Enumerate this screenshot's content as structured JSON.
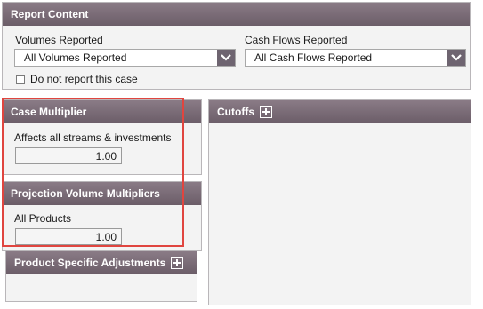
{
  "report_content": {
    "title": "Report Content",
    "volumes_label": "Volumes Reported",
    "volumes_value": "All Volumes Reported",
    "cashflows_label": "Cash Flows Reported",
    "cashflows_value": "All Cash Flows Reported",
    "do_not_report_label": "Do not report this case",
    "do_not_report_checked": false
  },
  "case_multiplier": {
    "title": "Case Multiplier",
    "description": "Affects all streams & investments",
    "value": "1.00"
  },
  "projection_volume_multipliers": {
    "title": "Projection Volume Multipliers",
    "label": "All Products",
    "value": "1.00"
  },
  "product_specific_adjustments": {
    "title": "Product Specific Adjustments"
  },
  "cutoffs": {
    "title": "Cutoffs"
  },
  "colors": {
    "header_bg": "#7a6c77",
    "dropdown_caret_bg": "#6e6470",
    "highlight_border": "#e0453f",
    "panel_bg": "#f3f3f3"
  },
  "icons": [
    "chevron-down-icon",
    "add-icon",
    "checkbox-icon"
  ]
}
